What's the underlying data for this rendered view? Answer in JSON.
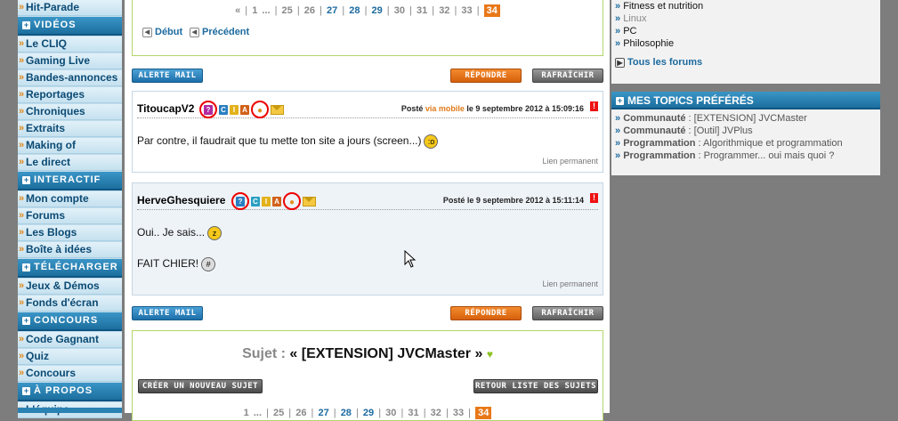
{
  "sidebar": {
    "top_item": "Hit-Parade",
    "sections": [
      {
        "title": "VIDÉOS",
        "items": [
          "Le CLIQ",
          "Gaming Live",
          "Bandes-annonces",
          "Reportages",
          "Chroniques",
          "Extraits",
          "Making of",
          "Le direct"
        ]
      },
      {
        "title": "INTERACTIF",
        "items": [
          "Mon compte",
          "Forums",
          "Les Blogs",
          "Boîte à idées"
        ]
      },
      {
        "title": "TÉLÉCHARGER",
        "items": [
          "Jeux & Démos",
          "Fonds d'écran"
        ]
      },
      {
        "title": "CONCOURS",
        "items": [
          "Code Gagnant",
          "Quiz",
          "Concours"
        ]
      },
      {
        "title": "À PROPOS",
        "items": [
          "L'équipe"
        ]
      }
    ]
  },
  "pager_top": {
    "prev": "«",
    "pages": [
      "1",
      "...",
      "25",
      "26",
      "27",
      "28",
      "29",
      "30",
      "31",
      "32",
      "33"
    ],
    "current": "34",
    "first_label": "Début",
    "prev_label": "Précédent"
  },
  "buttons": {
    "alert": "ALERTE MAIL",
    "reply": "RÉPONDRE",
    "refresh": "RAFRAÎCHIR",
    "new_topic": "CRÉER UN NOUVEAU SUJET",
    "back_list": "RETOUR LISTE DES SUJETS"
  },
  "posts": [
    {
      "author": "TitoucapV2",
      "date_prefix": "Posté",
      "via": "via mobile",
      "date": "le 9 septembre 2012 à 15:09:16",
      "lines": [
        "Par contre, il faudrait que tu mette ton site a jours (screen...)"
      ],
      "permalink": "Lien permanent"
    },
    {
      "author": "HerveGhesquiere",
      "date_prefix": "Posté",
      "via": "",
      "date": "le 9 septembre 2012 à 15:11:14",
      "lines": [
        "Oui.. Je sais...",
        "FAIT CHIER!"
      ],
      "permalink": "Lien permanent"
    }
  ],
  "topic": {
    "label": "Sujet :",
    "title": "« [EXTENSION] JVCMaster »"
  },
  "pager_bottom": {
    "pages": [
      "1",
      "...",
      "25",
      "26",
      "27",
      "28",
      "29",
      "30",
      "31",
      "32",
      "33"
    ],
    "current": "34"
  },
  "forums_box": {
    "items": [
      "Fitness et nutrition",
      "Linux",
      "PC",
      "Philosophie"
    ],
    "all_forums": "Tous les forums"
  },
  "favorites": {
    "title": "MES TOPICS PRÉFÉRÉS",
    "items": [
      {
        "category": "Communauté",
        "topic": "[EXTENSION] JVCMaster"
      },
      {
        "category": "Communauté",
        "topic": "[Outil] JVPlus"
      },
      {
        "category": "Programmation",
        "topic": "Algorithmique et programmation"
      },
      {
        "category": "Programmation",
        "topic": "Programmer... oui mais quoi ?"
      }
    ]
  },
  "colors": {
    "accent_orange": "#e87818",
    "link_blue": "#1c6a9f",
    "box_green_border": "#b3d56a",
    "nav_blue": "#1c6f9f"
  }
}
